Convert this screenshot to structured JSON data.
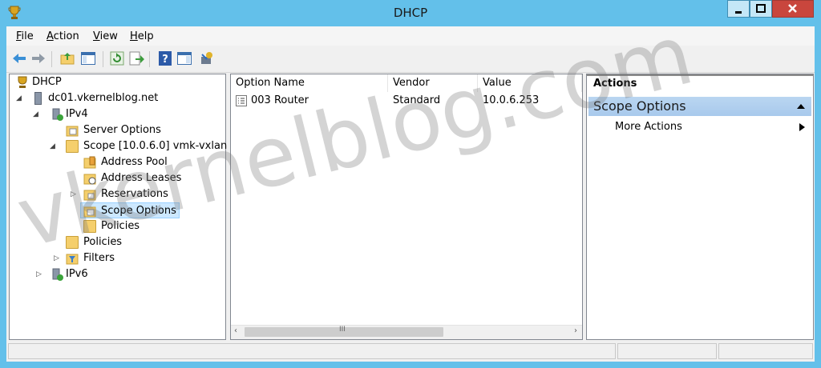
{
  "window": {
    "title": "DHCP"
  },
  "menu": [
    "File",
    "Action",
    "View",
    "Help"
  ],
  "tree": [
    {
      "label": "DHCP",
      "expander": ""
    },
    {
      "label": "dc01.vkernelblog.net",
      "expander": "◢"
    },
    {
      "label": "IPv4",
      "expander": "◢"
    },
    {
      "label": "Server Options",
      "expander": ""
    },
    {
      "label": "Scope [10.0.6.0] vmk-vxlan",
      "expander": "◢"
    },
    {
      "label": "Address Pool",
      "expander": ""
    },
    {
      "label": "Address Leases",
      "expander": ""
    },
    {
      "label": "Reservations",
      "expander": "▷"
    },
    {
      "label": "Scope Options",
      "expander": "",
      "selected": true
    },
    {
      "label": "Policies",
      "expander": ""
    },
    {
      "label": "Policies",
      "expander": ""
    },
    {
      "label": "Filters",
      "expander": "▷"
    },
    {
      "label": "IPv6",
      "expander": "▷"
    }
  ],
  "list": {
    "columns": [
      "Option Name",
      "Vendor",
      "Value"
    ],
    "rows": [
      [
        "003 Router",
        "Standard",
        "10.0.6.253"
      ]
    ],
    "scroll_mark": "III"
  },
  "actions": {
    "title": "Actions",
    "section": "Scope Options",
    "items": [
      "More Actions"
    ]
  },
  "watermark": "vkernelblog.com",
  "colors": {
    "frame": "#63c0ea",
    "close": "#c9463d",
    "selection": "#cce8ff",
    "section": "#b0cfee"
  }
}
